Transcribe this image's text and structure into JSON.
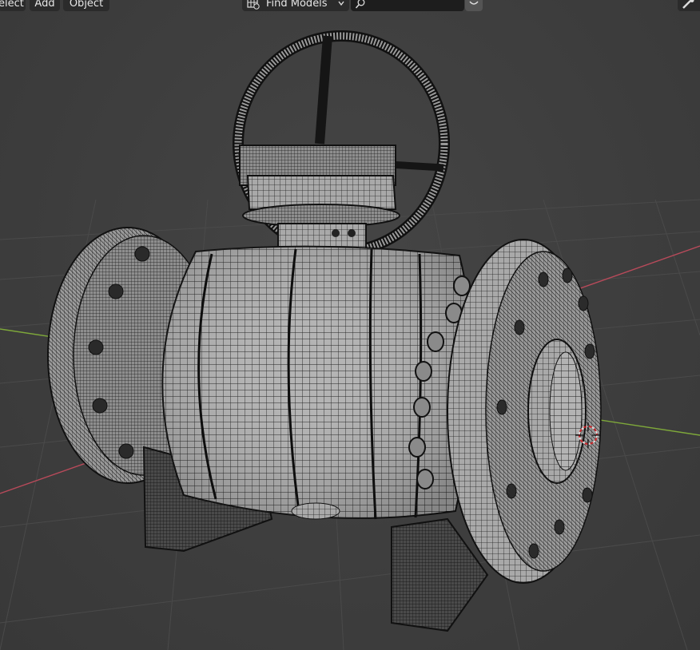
{
  "header": {
    "menu": {
      "select_label": "elect",
      "add_label": "Add",
      "object_label": "Object"
    },
    "find_models": {
      "label": "Find Models",
      "icon": "grid-globe-icon"
    },
    "search": {
      "value": "",
      "placeholder": "",
      "icon": "search-icon"
    },
    "search_submit_icon": "chevron-icon",
    "right_tool_icon": "brush-icon"
  },
  "viewport": {
    "background": "#3d3d3d",
    "grid_color": "#4a4a4a",
    "x_axis_color": "#b84a5a",
    "y_axis_color": "#7ea83a",
    "model_fill": "#a9a9a9",
    "wire_color": "#1b1b1b",
    "cursor_colors": [
      "#e0e0e0",
      "#c8262a"
    ]
  }
}
